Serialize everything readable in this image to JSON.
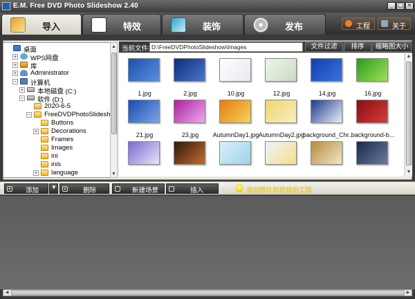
{
  "window": {
    "title": "E.M. Free DVD Photo Slideshow 2.40",
    "minimize": "_",
    "maximize": "□",
    "close": "×"
  },
  "tabs": [
    {
      "label": "导入",
      "icon": "import-icon",
      "active": true
    },
    {
      "label": "特效",
      "icon": "effects-icon",
      "active": false
    },
    {
      "label": "装饰",
      "icon": "decorate-icon",
      "active": false
    },
    {
      "label": "发布",
      "icon": "disc-icon",
      "active": false
    }
  ],
  "top_buttons": {
    "project": "工程",
    "about": "关于"
  },
  "tree": {
    "items": [
      {
        "label": "桌面",
        "icon": "desktop",
        "expander": ""
      },
      {
        "label": "WPS网盘",
        "icon": "cloud",
        "expander": "+"
      },
      {
        "label": "库",
        "icon": "library",
        "expander": "+"
      },
      {
        "label": "Administrator",
        "icon": "user",
        "expander": "+"
      },
      {
        "label": "计算机",
        "icon": "computer",
        "expander": "−"
      },
      {
        "label": "本地磁盘 (C:)",
        "icon": "drive",
        "expander": "+"
      },
      {
        "label": "软件 (D:)",
        "icon": "drive",
        "expander": "−"
      },
      {
        "label": "2020-6-5",
        "icon": "folder",
        "expander": ""
      },
      {
        "label": "FreeDVDPhotoSlideshow",
        "icon": "folder",
        "expander": "−"
      },
      {
        "label": "Buttons",
        "icon": "folder",
        "expander": ""
      },
      {
        "label": "Decorations",
        "icon": "folder",
        "expander": "+"
      },
      {
        "label": "Frames",
        "icon": "folder",
        "expander": ""
      },
      {
        "label": "Images",
        "icon": "folder",
        "expander": ""
      },
      {
        "label": "ini",
        "icon": "folder",
        "expander": ""
      },
      {
        "label": "inis",
        "icon": "folder",
        "expander": ""
      },
      {
        "label": "language",
        "icon": "folder",
        "expander": "+"
      }
    ]
  },
  "path": {
    "label": "当前文件夹",
    "value": "D:\\FreeDVDPhotoSlideshow\\Images"
  },
  "path_buttons": {
    "filter": "文件过滤",
    "sort": "排序",
    "thumb_size": "缩略图大小"
  },
  "thumbnails": [
    {
      "caption": "1.jpg",
      "colors": [
        "#1c4fae",
        "#5b8fe0"
      ]
    },
    {
      "caption": "2.jpg",
      "colors": [
        "#0d2c7c",
        "#4a74c8"
      ]
    },
    {
      "caption": "10.jpg",
      "colors": [
        "#ffffff",
        "#e8e8f0"
      ]
    },
    {
      "caption": "12.jpg",
      "colors": [
        "#eef4ea",
        "#c9dcc4"
      ]
    },
    {
      "caption": "14.jpg",
      "colors": [
        "#0f3fae",
        "#3b72de"
      ]
    },
    {
      "caption": "16.jpg",
      "colors": [
        "#2e9a1e",
        "#9fe05a"
      ]
    },
    {
      "caption": "21.jpg",
      "colors": [
        "#1a4ab0",
        "#7aa6ea"
      ]
    },
    {
      "caption": "23.jpg",
      "colors": [
        "#a8209e",
        "#f0a8ec"
      ]
    },
    {
      "caption": "AutumnDay1.jpg",
      "colors": [
        "#e87a10",
        "#f6d25a"
      ]
    },
    {
      "caption": "AutumnDay2.jpg",
      "colors": [
        "#f2d270",
        "#f7f0c0"
      ]
    },
    {
      "caption": "background_Chr...",
      "colors": [
        "#1c3c8a",
        "#e8eef8"
      ]
    },
    {
      "caption": "background-b...",
      "colors": [
        "#8a0e10",
        "#d43c3c"
      ]
    },
    {
      "caption": "",
      "colors": [
        "#7a6ad0",
        "#e8e4fa"
      ]
    },
    {
      "caption": "",
      "colors": [
        "#2a1a10",
        "#c86a2a"
      ]
    },
    {
      "caption": "",
      "colors": [
        "#d8f0fa",
        "#9ed2ea"
      ]
    },
    {
      "caption": "",
      "colors": [
        "#eaf4fa",
        "#f8e08a"
      ]
    },
    {
      "caption": "",
      "colors": [
        "#b88a3a",
        "#f0e6c8"
      ]
    },
    {
      "caption": "",
      "colors": [
        "#1a2a4a",
        "#6a7aa0"
      ]
    }
  ],
  "actions": {
    "add": "添加",
    "dropdown": "▼",
    "delete": "删除",
    "new_scene": "新建场景",
    "insert": "插入"
  },
  "hint": "添加照片和视频到工程",
  "colors": {
    "accent": "#e6c000",
    "panel": "#eae7dd",
    "timeline": "#606060"
  }
}
